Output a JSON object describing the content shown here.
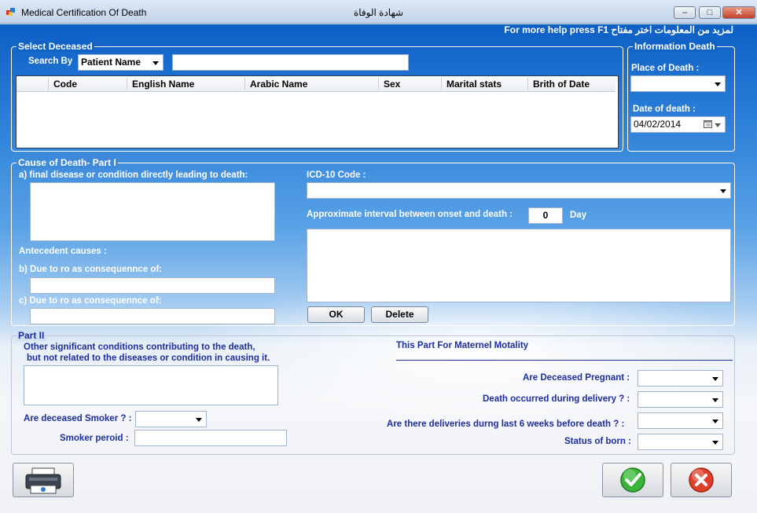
{
  "window": {
    "title": "Medical Certification Of Death",
    "title_arabic": "شهادة الوفاة",
    "minimize": "‒",
    "maximize": "□",
    "close": "✕"
  },
  "help_text": "For more help press F1  لمزيد من المعلومات اختر مفتاح",
  "select_deceased": {
    "legend": "Select Deceased",
    "search_by_label": "Search By",
    "search_by_value": "Patient Name",
    "search_text": "",
    "columns": [
      "Code",
      "English Name",
      "Arabic Name",
      "Sex",
      "Marital stats",
      "Brith of Date"
    ]
  },
  "information_death": {
    "legend": "Information Death",
    "place_label": "Place of Death :",
    "place_value": "",
    "date_label": "Date of death :",
    "date_value": "04/02/2014"
  },
  "cause_part1": {
    "legend": "Cause of Death- Part  I",
    "a_label": "a)  final disease or condition directly leading to death:",
    "antecedent_label": "Antecedent causes :",
    "b_label": "b)  Due to ro as consequennce of:",
    "c_label": "c)  Due to ro as consequennce of:",
    "icd_label": "ICD-10 Code :",
    "interval_label": "Approximate interval between onset and death :",
    "interval_value": "0",
    "interval_unit": "Day",
    "ok_label": "OK",
    "delete_label": "Delete"
  },
  "part2": {
    "legend": "Part II",
    "other_conditions_line1": "Other significant conditions contributing to the death,",
    "other_conditions_line2": "but not related to the diseases or condition in causing it.",
    "smoker_label": "Are deceased Smoker ? :",
    "smoker_period_label": "Smoker peroid :",
    "maternal_title": "This Part For Maternel Motality",
    "pregnant_label": "Are Deceased Pregnant :",
    "delivery_label": "Death occurred during delivery ? :",
    "deliveries_label": "Are there deliveries durng last 6 weeks before death ? :",
    "status_born_label": "Status of born :"
  },
  "colors": {
    "accent": "#1467c8",
    "label_blue": "#1d2f9e"
  },
  "icons": {
    "print": "printer-icon",
    "save": "check-icon",
    "cancel": "cancel-x-icon"
  }
}
